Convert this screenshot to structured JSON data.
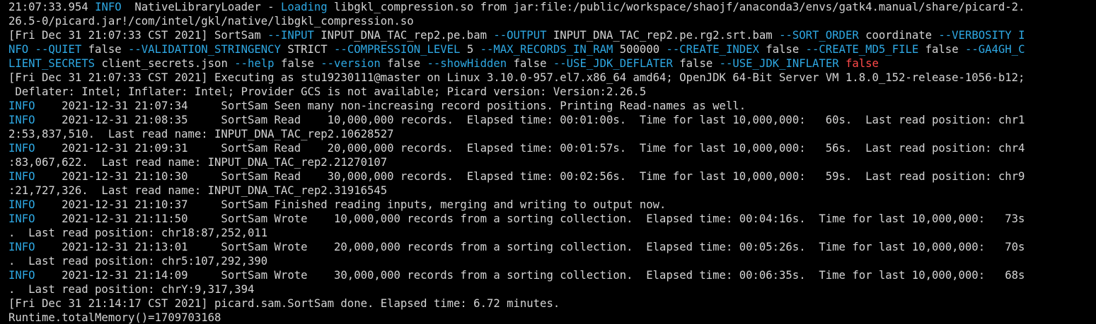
{
  "colors": {
    "background": "#000000",
    "text": "#d4d4d4",
    "info": "#2ea8e3",
    "false_value": "#ff4a4a"
  },
  "terminal": {
    "lines": [
      [
        {
          "t": "21:07:33.954 ",
          "c": "white"
        },
        {
          "t": "INFO",
          "c": "blue"
        },
        {
          "t": "  NativeLibraryLoader - ",
          "c": "white"
        },
        {
          "t": "Loading",
          "c": "blue"
        },
        {
          "t": " libgkl_compression.so from jar:file:/public/workspace/shaojf/anaconda3/envs/gatk4.manual/share/picard-2.",
          "c": "white"
        }
      ],
      [
        {
          "t": "26.5-0/picard.jar!/com/intel/gkl/native/libgkl_compression.so",
          "c": "white"
        }
      ],
      [
        {
          "t": "[Fri Dec 31 21:07:33 CST 2021] SortSam ",
          "c": "white"
        },
        {
          "t": "--INPUT",
          "c": "blue"
        },
        {
          "t": " INPUT_DNA_TAC_rep2.pe.bam ",
          "c": "white"
        },
        {
          "t": "--OUTPUT",
          "c": "blue"
        },
        {
          "t": " INPUT_DNA_TAC_rep2.pe.rg2.srt.bam ",
          "c": "white"
        },
        {
          "t": "--SORT_ORDER",
          "c": "blue"
        },
        {
          "t": " coordinate ",
          "c": "white"
        },
        {
          "t": "--VERBOSITY I",
          "c": "blue"
        }
      ],
      [
        {
          "t": "NFO --QUIET",
          "c": "blue"
        },
        {
          "t": " false ",
          "c": "white"
        },
        {
          "t": "--VALIDATION_STRINGENCY",
          "c": "blue"
        },
        {
          "t": " STRICT ",
          "c": "white"
        },
        {
          "t": "--COMPRESSION_LEVEL",
          "c": "blue"
        },
        {
          "t": " 5 ",
          "c": "white"
        },
        {
          "t": "--MAX_RECORDS_IN_RAM",
          "c": "blue"
        },
        {
          "t": " 500000 ",
          "c": "white"
        },
        {
          "t": "--CREATE_INDEX",
          "c": "blue"
        },
        {
          "t": " false ",
          "c": "white"
        },
        {
          "t": "--CREATE_MD5_FILE",
          "c": "blue"
        },
        {
          "t": " false ",
          "c": "white"
        },
        {
          "t": "--GA4GH_C",
          "c": "blue"
        }
      ],
      [
        {
          "t": "LIENT_SECRETS",
          "c": "blue"
        },
        {
          "t": " client_secrets.json ",
          "c": "white"
        },
        {
          "t": "--help",
          "c": "blue"
        },
        {
          "t": " false ",
          "c": "white"
        },
        {
          "t": "--version",
          "c": "blue"
        },
        {
          "t": " false ",
          "c": "white"
        },
        {
          "t": "--showHidden",
          "c": "blue"
        },
        {
          "t": " false ",
          "c": "white"
        },
        {
          "t": "--USE_JDK_DEFLATER",
          "c": "blue"
        },
        {
          "t": " false ",
          "c": "white"
        },
        {
          "t": "--USE_JDK_INFLATER",
          "c": "blue"
        },
        {
          "t": " false",
          "c": "red"
        }
      ],
      [
        {
          "t": "[Fri Dec 31 21:07:33 CST 2021] Executing as stu19230111@master on Linux 3.10.0-957.el7.x86_64 amd64; OpenJDK 64-Bit Server VM 1.8.0_152-release-1056-b12;",
          "c": "white"
        }
      ],
      [
        {
          "t": " Deflater: Intel; Inflater: Intel; Provider GCS is not available; Picard version: Version:2.26.5",
          "c": "white"
        }
      ],
      [
        {
          "t": "INFO",
          "c": "blue"
        },
        {
          "t": "\t2021-12-31 21:07:34\tSortSam\tSeen many non-increasing record positions. Printing Read-names as well.",
          "c": "white"
        }
      ],
      [
        {
          "t": "INFO",
          "c": "blue"
        },
        {
          "t": "\t2021-12-31 21:08:35\tSortSam\tRead    10,000,000 records.  Elapsed time: 00:01:00s.  Time for last 10,000,000:   60s.  Last read position: chr1",
          "c": "white"
        }
      ],
      [
        {
          "t": "2:53,837,510.  Last read name: INPUT_DNA_TAC_rep2.10628527",
          "c": "white"
        }
      ],
      [
        {
          "t": "INFO",
          "c": "blue"
        },
        {
          "t": "\t2021-12-31 21:09:31\tSortSam\tRead    20,000,000 records.  Elapsed time: 00:01:57s.  Time for last 10,000,000:   56s.  Last read position: chr4",
          "c": "white"
        }
      ],
      [
        {
          "t": ":83,067,622.  Last read name: INPUT_DNA_TAC_rep2.21270107",
          "c": "white"
        }
      ],
      [
        {
          "t": "INFO",
          "c": "blue"
        },
        {
          "t": "\t2021-12-31 21:10:30\tSortSam\tRead    30,000,000 records.  Elapsed time: 00:02:56s.  Time for last 10,000,000:   59s.  Last read position: chr9",
          "c": "white"
        }
      ],
      [
        {
          "t": ":21,727,326.  Last read name: INPUT_DNA_TAC_rep2.31916545",
          "c": "white"
        }
      ],
      [
        {
          "t": "INFO",
          "c": "blue"
        },
        {
          "t": "\t2021-12-31 21:10:37\tSortSam\tFinished reading inputs, merging and writing to output now.",
          "c": "white"
        }
      ],
      [
        {
          "t": "INFO",
          "c": "blue"
        },
        {
          "t": "\t2021-12-31 21:11:50\tSortSam\tWrote    10,000,000 records from a sorting collection.  Elapsed time: 00:04:16s.  Time for last 10,000,000:   73s",
          "c": "white"
        }
      ],
      [
        {
          "t": ".  Last read position: chr18:87,252,011",
          "c": "white"
        }
      ],
      [
        {
          "t": "INFO",
          "c": "blue"
        },
        {
          "t": "\t2021-12-31 21:13:01\tSortSam\tWrote    20,000,000 records from a sorting collection.  Elapsed time: 00:05:26s.  Time for last 10,000,000:   70s",
          "c": "white"
        }
      ],
      [
        {
          "t": ".  Last read position: chr5:107,292,390",
          "c": "white"
        }
      ],
      [
        {
          "t": "INFO",
          "c": "blue"
        },
        {
          "t": "\t2021-12-31 21:14:09\tSortSam\tWrote    30,000,000 records from a sorting collection.  Elapsed time: 00:06:35s.  Time for last 10,000,000:   68s",
          "c": "white"
        }
      ],
      [
        {
          "t": ".  Last read position: chrY:9,317,394",
          "c": "white"
        }
      ],
      [
        {
          "t": "[Fri Dec 31 21:14:17 CST 2021] picard.sam.SortSam done. Elapsed time: 6.72 minutes.",
          "c": "white"
        }
      ],
      [
        {
          "t": "Runtime.totalMemory()=1709703168",
          "c": "white"
        }
      ]
    ]
  }
}
